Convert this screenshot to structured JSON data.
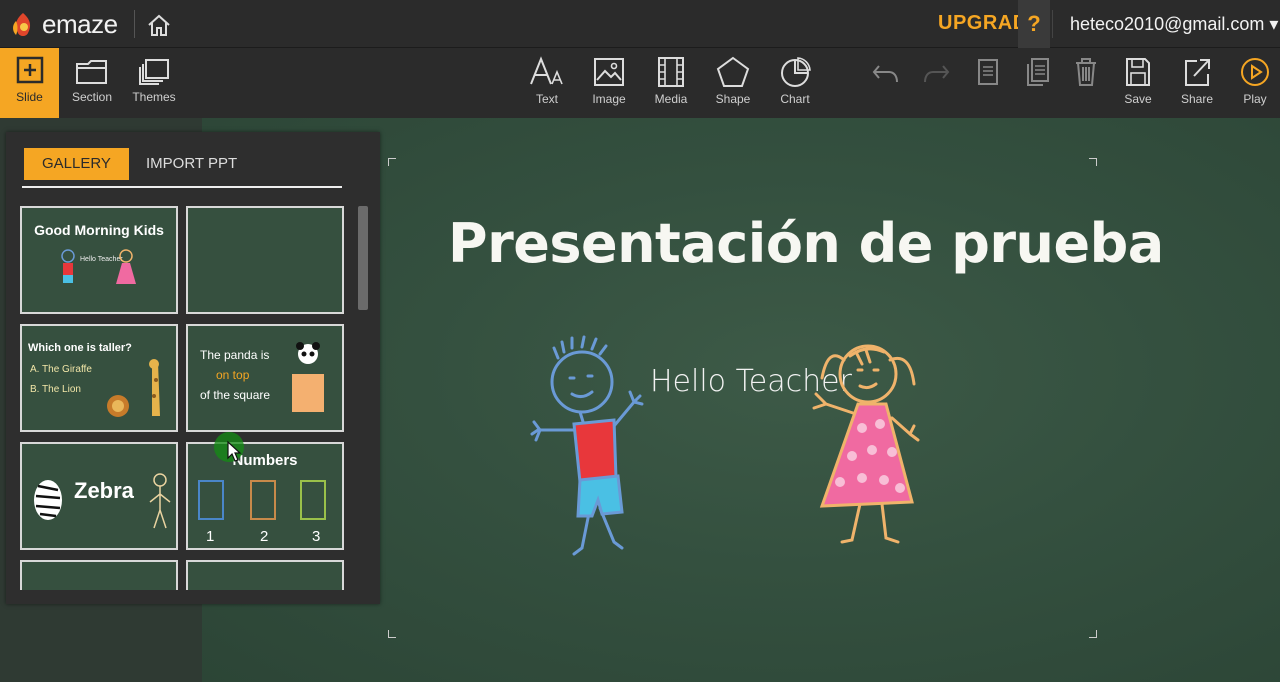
{
  "app": {
    "logo_text": "emaze",
    "upgrade_label": "UPGRADE",
    "help_label": "?",
    "user_email": "heteco2010@gmail.com ▾"
  },
  "toolbar": {
    "left": [
      {
        "label": "Slide",
        "icon": "plus-icon"
      },
      {
        "label": "Section",
        "icon": "folder-icon"
      },
      {
        "label": "Themes",
        "icon": "layers-icon"
      }
    ],
    "insert": [
      {
        "label": "Text",
        "icon": "text-icon"
      },
      {
        "label": "Image",
        "icon": "image-icon"
      },
      {
        "label": "Media",
        "icon": "film-icon"
      },
      {
        "label": "Shape",
        "icon": "pentagon-icon"
      },
      {
        "label": "Chart",
        "icon": "pie-chart-icon"
      }
    ],
    "actions": [
      {
        "label": "Save",
        "icon": "save-icon"
      },
      {
        "label": "Share",
        "icon": "share-icon"
      },
      {
        "label": "Play",
        "icon": "play-icon"
      }
    ]
  },
  "gallery": {
    "tabs": [
      "GALLERY",
      "IMPORT PPT"
    ],
    "thumbnails": [
      {
        "title": "Good Morning Kids",
        "caption": "Hello Teacher"
      },
      {
        "title": "",
        "caption": ""
      },
      {
        "title": "Which one is taller?",
        "line_a": "A. The Giraffe",
        "line_b": "B. The Lion"
      },
      {
        "line_1": "The panda is",
        "line_2": "on top",
        "line_3": "of the square"
      },
      {
        "title": "Zebra"
      },
      {
        "title": "Numbers",
        "numbers": [
          "1",
          "2",
          "3"
        ]
      }
    ]
  },
  "slide": {
    "title": "Presentación de prueba",
    "subtitle": "Hello Teacher"
  },
  "colors": {
    "accent": "#f5a623",
    "chalkboard": "#3a5645",
    "toolbar": "#2b2b2b"
  }
}
